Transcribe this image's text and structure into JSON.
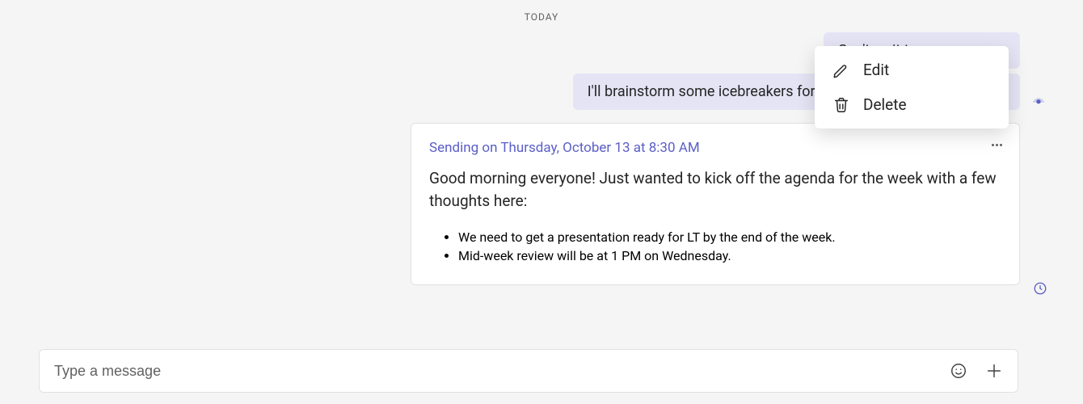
{
  "date_divider": "TODAY",
  "messages": {
    "sent1": "Can't wait to see everyone",
    "sent2": "I'll brainstorm some icebreakers for our team standup next week!"
  },
  "scheduled": {
    "timestamp": "Sending on Thursday, October 13 at 8:30 AM",
    "body": "Good morning everyone! Just wanted to kick off the agenda for the week with a few thoughts here:",
    "bullets": [
      "We need to get a presentation ready for LT by the end of the week.",
      "Mid-week review will be at 1 PM on Wednesday."
    ]
  },
  "context_menu": {
    "edit": "Edit",
    "delete": "Delete"
  },
  "composer": {
    "placeholder": "Type a message"
  }
}
